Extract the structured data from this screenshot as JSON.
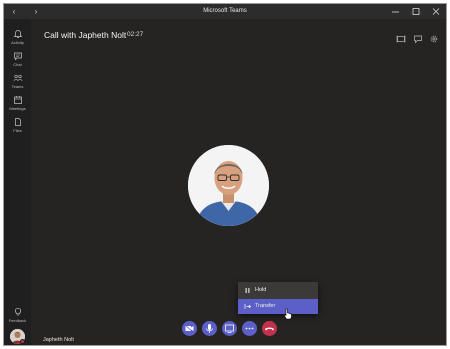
{
  "window": {
    "title": "Microsoft Teams",
    "back_glyph": "‹",
    "forward_glyph": "›"
  },
  "rail": {
    "items": [
      {
        "label": "Activity",
        "icon": "bell-icon"
      },
      {
        "label": "Chat",
        "icon": "chat-icon"
      },
      {
        "label": "Teams",
        "icon": "teams-icon"
      },
      {
        "label": "Meetings",
        "icon": "calendar-icon"
      },
      {
        "label": "Files",
        "icon": "file-icon"
      }
    ],
    "feedback_label": "Feedback"
  },
  "call": {
    "title": "Call with Japheth Nolt",
    "duration": "02:27",
    "caller_name": "Japheth Nolt"
  },
  "menu": {
    "items": [
      {
        "label": "Hold",
        "icon": "pause-icon",
        "highlighted": false
      },
      {
        "label": "Transfer",
        "icon": "transfer-icon",
        "highlighted": true
      }
    ]
  },
  "controls": [
    "video-icon",
    "mic-icon",
    "share-screen-icon",
    "more-icon",
    "hangup-icon"
  ],
  "colors": {
    "accent": "#5b5fc7",
    "hangup": "#c4314b",
    "background": "#252423",
    "rail": "#1f1f1f"
  }
}
